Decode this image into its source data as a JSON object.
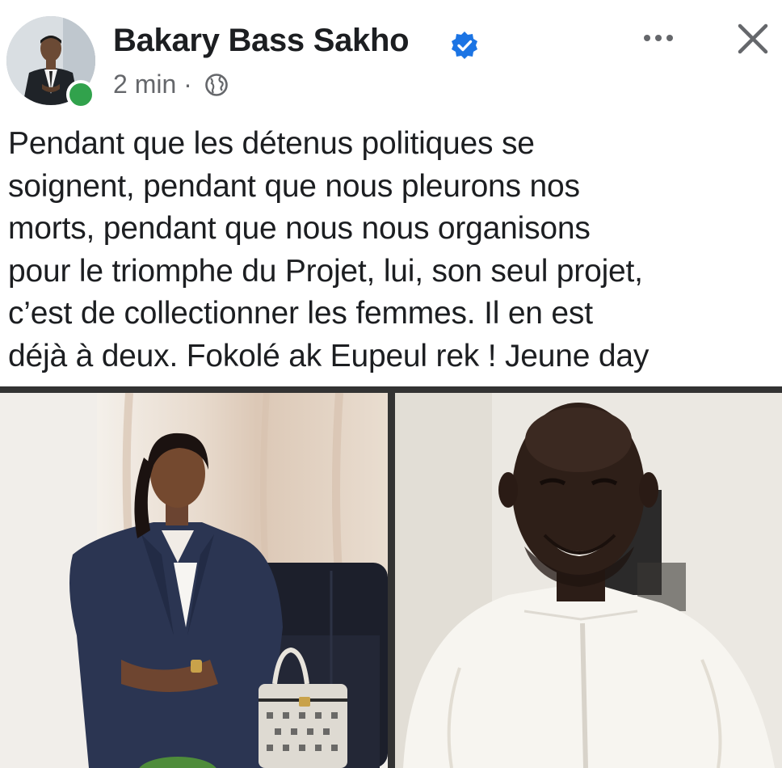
{
  "post": {
    "author": "Bakary Bass Sakho",
    "timestamp": "2 min",
    "separator": "·",
    "privacy_icon": "globe-icon",
    "verified_icon": "verified-badge-icon",
    "more_icon": "more-horizontal-icon",
    "close_icon": "close-icon",
    "text_lines": [
      "Pendant que les détenus politiques se",
      "soignent, pendant que nous pleurons nos",
      "morts, pendant que nous nous organisons",
      "pour le triomphe du Projet, lui, son seul projet,",
      "c’est de collectionner les femmes. Il en est",
      "déjà à deux. Fokolé ak Eupeul rek ! Jeune day"
    ]
  },
  "colors": {
    "verified": "#1b74e4",
    "online": "#31a24c",
    "text": "#1c1e21",
    "secondary_text": "#65676b"
  }
}
